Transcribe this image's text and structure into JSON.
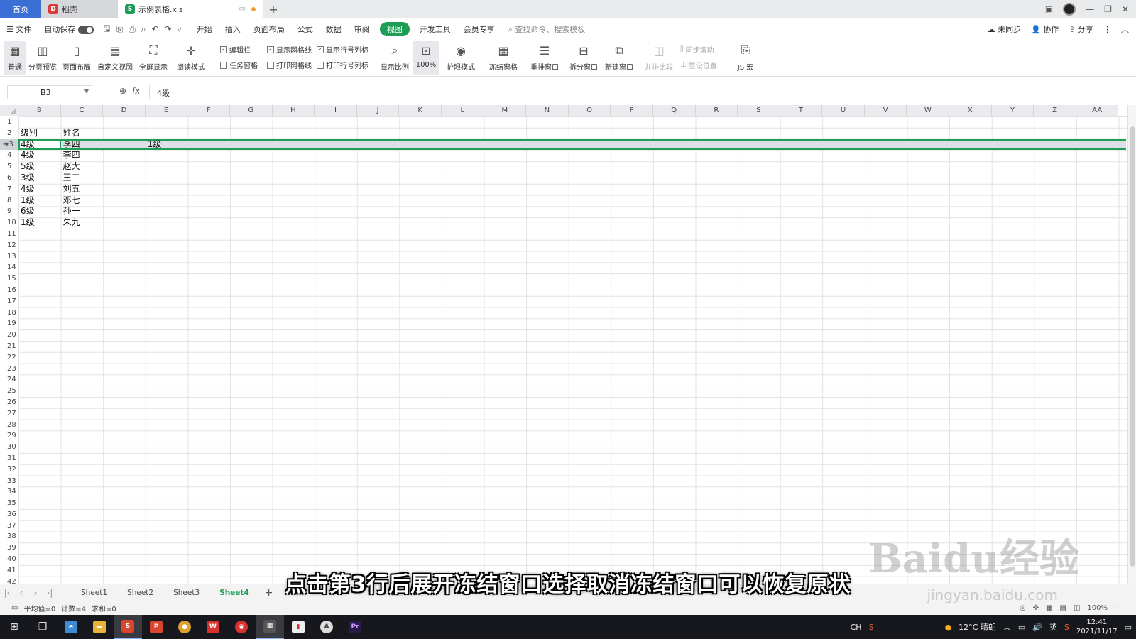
{
  "titlebar": {
    "home_tab": "首页",
    "daoke_tab": "稻壳",
    "file_tab": "示例表格.xls",
    "new_tab": "+"
  },
  "menubar": {
    "file": "文件",
    "autosave": "自动保存",
    "items": [
      "开始",
      "插入",
      "页面布局",
      "公式",
      "数据",
      "审阅",
      "视图",
      "开发工具",
      "会员专享"
    ],
    "active": "视图",
    "search_placeholder": "查找命令、搜索模板",
    "right": [
      "未同步",
      "协作",
      "分享"
    ]
  },
  "ribbon": {
    "buttons": [
      "普通",
      "分页预览",
      "页面布局",
      "自定义视图",
      "全屏显示",
      "阅读模式",
      "显示比例",
      "100%",
      "护眼模式",
      "冻结窗格",
      "重排窗口",
      "拆分窗口",
      "新建窗口",
      "并排比较",
      "JS 宏"
    ],
    "checks": [
      {
        "label": "编辑栏",
        "checked": true
      },
      {
        "label": "显示网格线",
        "checked": true
      },
      {
        "label": "显示行号列标",
        "checked": true
      },
      {
        "label": "任务窗格",
        "checked": false
      },
      {
        "label": "打印网格线",
        "checked": false
      },
      {
        "label": "打印行号列标",
        "checked": false
      }
    ],
    "disabled": [
      "同步滚动",
      "重设位置"
    ]
  },
  "formula": {
    "namebox": "B3",
    "fx": "fx",
    "value": "4级"
  },
  "columns": [
    "B",
    "C",
    "D",
    "E",
    "F",
    "G",
    "H",
    "I",
    "J",
    "K",
    "L",
    "M",
    "N",
    "O",
    "P",
    "Q",
    "R",
    "S",
    "T",
    "U",
    "V",
    "W",
    "X",
    "Y",
    "Z",
    "AA"
  ],
  "row_count": 42,
  "selected_row": 3,
  "cells": [
    {
      "row": 2,
      "col": "B",
      "text": "级别"
    },
    {
      "row": 2,
      "col": "C",
      "text": "姓名"
    },
    {
      "row": 3,
      "col": "B",
      "text": "4级"
    },
    {
      "row": 3,
      "col": "C",
      "text": "李四"
    },
    {
      "row": 3,
      "col": "E",
      "text": "1级"
    },
    {
      "row": 4,
      "col": "B",
      "text": "4级"
    },
    {
      "row": 4,
      "col": "C",
      "text": "李四"
    },
    {
      "row": 5,
      "col": "B",
      "text": "5级"
    },
    {
      "row": 5,
      "col": "C",
      "text": "赵大"
    },
    {
      "row": 6,
      "col": "B",
      "text": "3级"
    },
    {
      "row": 6,
      "col": "C",
      "text": "王二"
    },
    {
      "row": 7,
      "col": "B",
      "text": "4级"
    },
    {
      "row": 7,
      "col": "C",
      "text": "刘五"
    },
    {
      "row": 8,
      "col": "B",
      "text": "1级"
    },
    {
      "row": 8,
      "col": "C",
      "text": "邓七"
    },
    {
      "row": 9,
      "col": "B",
      "text": "6级"
    },
    {
      "row": 9,
      "col": "C",
      "text": "孙一"
    },
    {
      "row": 10,
      "col": "B",
      "text": "1级"
    },
    {
      "row": 10,
      "col": "C",
      "text": "朱九"
    }
  ],
  "sheets": [
    "Sheet1",
    "Sheet2",
    "Sheet3",
    "Sheet4"
  ],
  "active_sheet": "Sheet4",
  "statusbar": {
    "average": "平均值=0",
    "count": "计数=4",
    "sum": "求和=0",
    "zoom": "100%"
  },
  "taskbar": {
    "weather": "12°C 晴朗",
    "ime": "英",
    "ch": "CH",
    "time": "12:41",
    "date": "2021/11/17"
  },
  "caption": "点击第3行后展开冻结窗口选择取消冻结窗口可以恢复原状",
  "watermark": "Baidu经验",
  "watermark_url": "jingyan.baidu.com",
  "colors": {
    "accent": "#1e9d55",
    "home_tab": "#3b6fd6",
    "taskbar": "#17181d"
  }
}
